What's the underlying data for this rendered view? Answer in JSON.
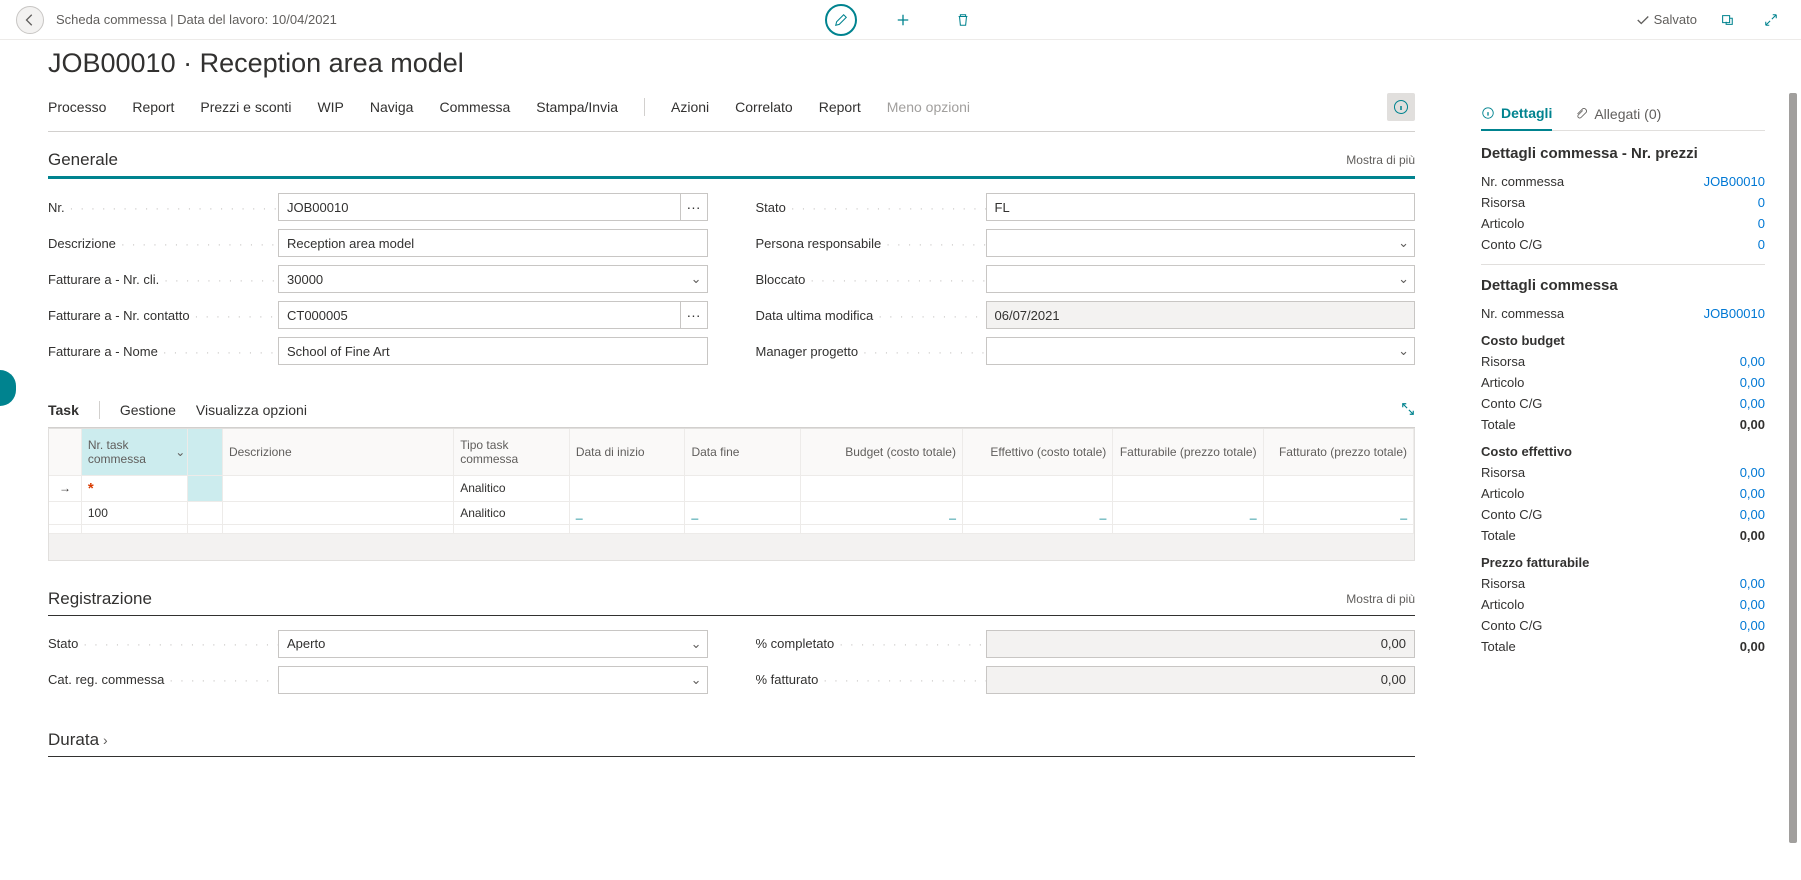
{
  "breadcrumb": "Scheda commessa | Data del lavoro: 10/04/2021",
  "saved_label": "Salvato",
  "page_title": "JOB00010 · Reception area model",
  "menu": [
    "Processo",
    "Report",
    "Prezzi e sconti",
    "WIP",
    "Naviga",
    "Commessa",
    "Stampa/Invia"
  ],
  "menu2": [
    "Azioni",
    "Correlato",
    "Report"
  ],
  "less_options": "Meno opzioni",
  "sections": {
    "general": {
      "title": "Generale",
      "show_more": "Mostra di più"
    },
    "task": {
      "title": "Task",
      "gestione": "Gestione",
      "opts": "Visualizza opzioni"
    },
    "reg": {
      "title": "Registrazione",
      "show_more": "Mostra di più"
    },
    "durata": {
      "title": "Durata"
    }
  },
  "fields": {
    "nr": {
      "label": "Nr.",
      "value": "JOB00010"
    },
    "descr": {
      "label": "Descrizione",
      "value": "Reception area model"
    },
    "bill_cli": {
      "label": "Fatturare a - Nr. cli.",
      "value": "30000"
    },
    "bill_cont": {
      "label": "Fatturare a - Nr. contatto",
      "value": "CT000005"
    },
    "bill_nome": {
      "label": "Fatturare a - Nome",
      "value": "School of Fine Art"
    },
    "stato": {
      "label": "Stato",
      "value": "FL"
    },
    "persona": {
      "label": "Persona responsabile",
      "value": ""
    },
    "bloccato": {
      "label": "Bloccato",
      "value": ""
    },
    "ult_mod": {
      "label": "Data ultima modifica",
      "value": "06/07/2021"
    },
    "manager": {
      "label": "Manager progetto",
      "value": ""
    },
    "reg_stato": {
      "label": "Stato",
      "value": "Aperto"
    },
    "reg_cat": {
      "label": "Cat. reg. commessa",
      "value": ""
    },
    "pct_compl": {
      "label": "% completato",
      "value": "0,00"
    },
    "pct_fatt": {
      "label": "% fatturato",
      "value": "0,00"
    }
  },
  "grid": {
    "cols": {
      "task_no": "Nr. task commessa",
      "descr": "Descrizione",
      "tipo": "Tipo task commessa",
      "inizio": "Data di inizio",
      "fine": "Data fine",
      "budget": "Budget (costo totale)",
      "effettivo": "Effettivo (costo totale)",
      "fatturabile": "Fatturabile (prezzo totale)",
      "fatturato": "Fatturato (prezzo totale)"
    },
    "rows": [
      {
        "active": true,
        "task_no": "*",
        "req": true,
        "descr": "",
        "tipo": "Analitico",
        "inizio": "",
        "fine": "",
        "budget": "",
        "effettivo": "",
        "fatturabile": "",
        "fatturato": ""
      },
      {
        "active": false,
        "task_no": "100",
        "req": false,
        "descr": "",
        "tipo": "Analitico",
        "inizio": "_",
        "fine": "_",
        "budget": "_",
        "effettivo": "_",
        "fatturabile": "_",
        "fatturato": "_"
      }
    ]
  },
  "factbox": {
    "tabs": {
      "dettagli": "Dettagli",
      "allegati": "Allegati (0)"
    },
    "box1": {
      "title": "Dettagli commessa - Nr. prezzi",
      "items": [
        {
          "l": "Nr. commessa",
          "v": "JOB00010",
          "link": true
        },
        {
          "l": "Risorsa",
          "v": "0",
          "link": true
        },
        {
          "l": "Articolo",
          "v": "0",
          "link": true
        },
        {
          "l": "Conto C/G",
          "v": "0",
          "link": true
        }
      ]
    },
    "box2": {
      "title": "Dettagli commessa",
      "nr": {
        "l": "Nr. commessa",
        "v": "JOB00010"
      },
      "groups": [
        {
          "h": "Costo budget",
          "rows": [
            {
              "l": "Risorsa",
              "v": "0,00"
            },
            {
              "l": "Articolo",
              "v": "0,00"
            },
            {
              "l": "Conto C/G",
              "v": "0,00"
            },
            {
              "l": "Totale",
              "v": "0,00",
              "bold": true
            }
          ]
        },
        {
          "h": "Costo effettivo",
          "rows": [
            {
              "l": "Risorsa",
              "v": "0,00"
            },
            {
              "l": "Articolo",
              "v": "0,00"
            },
            {
              "l": "Conto C/G",
              "v": "0,00"
            },
            {
              "l": "Totale",
              "v": "0,00",
              "bold": true
            }
          ]
        },
        {
          "h": "Prezzo fatturabile",
          "rows": [
            {
              "l": "Risorsa",
              "v": "0,00"
            },
            {
              "l": "Articolo",
              "v": "0,00"
            },
            {
              "l": "Conto C/G",
              "v": "0,00"
            },
            {
              "l": "Totale",
              "v": "0,00",
              "bold": true
            }
          ]
        }
      ]
    }
  }
}
